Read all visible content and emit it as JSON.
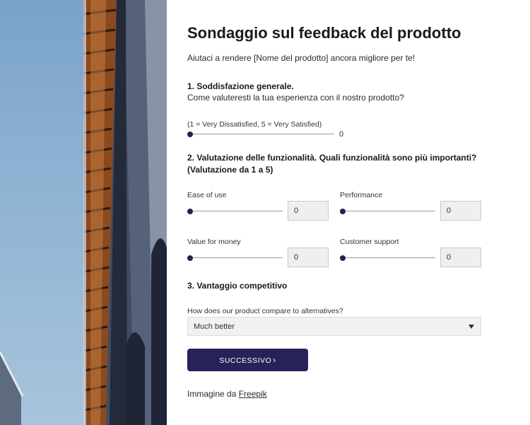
{
  "survey": {
    "title": "Sondaggio sul feedback del prodotto",
    "subtitle": "Aiutaci a rendere [Nome del prodotto] ancora migliore per te!"
  },
  "q1": {
    "heading": "1. Soddisfazione generale.",
    "question": "Come valuteresti la tua esperienza con il nostro prodotto?",
    "scale_hint": "(1 = Very Dissatisfied, 5 = Very Satisfied)",
    "value": "0"
  },
  "q2": {
    "heading_line1": "2. Valutazione delle funzionalità. Quali funzionalità sono più importanti?",
    "heading_line2": "(Valutazione da 1 a 5)",
    "items": [
      {
        "label": "Ease of use",
        "value": "0"
      },
      {
        "label": "Performance",
        "value": "0"
      },
      {
        "label": "Value for money",
        "value": "0"
      },
      {
        "label": "Customer support",
        "value": "0"
      }
    ]
  },
  "q3": {
    "heading": "3. Vantaggio competitivo",
    "question": "How does our product compare to alternatives?",
    "selected": "Much better"
  },
  "actions": {
    "next_label": "SUCCESSIVO",
    "next_icon": "chevron-right-icon"
  },
  "credit": {
    "prefix": "Immagine da",
    "link": "Freepik"
  },
  "colors": {
    "accent": "#26235a",
    "slider_thumb": "#24224f",
    "input_bg": "#efefef"
  }
}
